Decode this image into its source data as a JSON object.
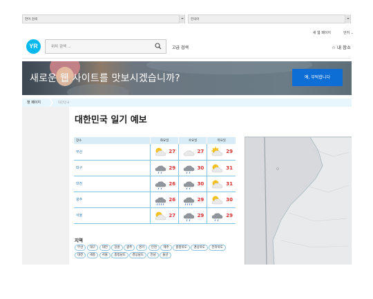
{
  "language_bar": {
    "left_select": "언어 검색",
    "right_select": "한국어"
  },
  "header": {
    "new_page_link": "새 웹 페이지",
    "language_link": "언어",
    "logo": "YR",
    "search_placeholder": "위치 검색 ...",
    "advanced_search": "고급 검색",
    "my_places": "내 장소"
  },
  "banner": {
    "headline": "새로운 웹 사이트를 맛보시겠습니까?",
    "cta": "예, 부탁합니다"
  },
  "breadcrumb": {
    "home": "첫 페이지",
    "current": "대한민국"
  },
  "main": {
    "title": "대한민국 일기 예보",
    "table": {
      "headers": [
        "장소",
        "화요일",
        "수요일",
        "목요일"
      ],
      "rows": [
        {
          "city": "부산",
          "days": [
            {
              "icon": "partly-cloudy-icon",
              "temp": "27"
            },
            {
              "icon": "cloudy-icon",
              "temp": "27"
            },
            {
              "icon": "sun-cloud-icon",
              "temp": "29"
            }
          ]
        },
        {
          "city": "대구",
          "days": [
            {
              "icon": "rain-cloud-icon",
              "temp": "29"
            },
            {
              "icon": "rain-cloud-icon",
              "temp": "30"
            },
            {
              "icon": "partly-cloudy-icon",
              "temp": "31"
            }
          ]
        },
        {
          "city": "대전",
          "days": [
            {
              "icon": "light-rain-icon",
              "temp": "26"
            },
            {
              "icon": "rain-cloud-icon",
              "temp": "30"
            },
            {
              "icon": "partly-cloudy-icon",
              "temp": "31"
            }
          ]
        },
        {
          "city": "광주",
          "days": [
            {
              "icon": "heavy-rain-icon",
              "temp": "26"
            },
            {
              "icon": "heavy-rain-icon",
              "temp": "29"
            },
            {
              "icon": "partly-cloudy-icon",
              "temp": "30"
            }
          ]
        },
        {
          "city": "서울",
          "days": [
            {
              "icon": "partly-cloudy-icon",
              "temp": "27"
            },
            {
              "icon": "light-rain-icon",
              "temp": "29"
            },
            {
              "icon": "light-rain-icon",
              "temp": "29"
            }
          ]
        }
      ]
    },
    "regions_title": "지역",
    "regions": [
      "부산",
      "대구",
      "대전",
      "강원",
      "광주",
      "경기",
      "인천",
      "제주",
      "충청북도",
      "경상북도",
      "전라북도",
      "대전",
      "세종",
      "서울",
      "충청남도",
      "경상남도",
      "전남",
      "울산"
    ]
  },
  "colors": {
    "accent": "#0d6fd6",
    "temp": "#d92e2e",
    "link": "#2a7ab5",
    "logo": "#00b9f1",
    "table_rule": "#7fc4e3"
  }
}
